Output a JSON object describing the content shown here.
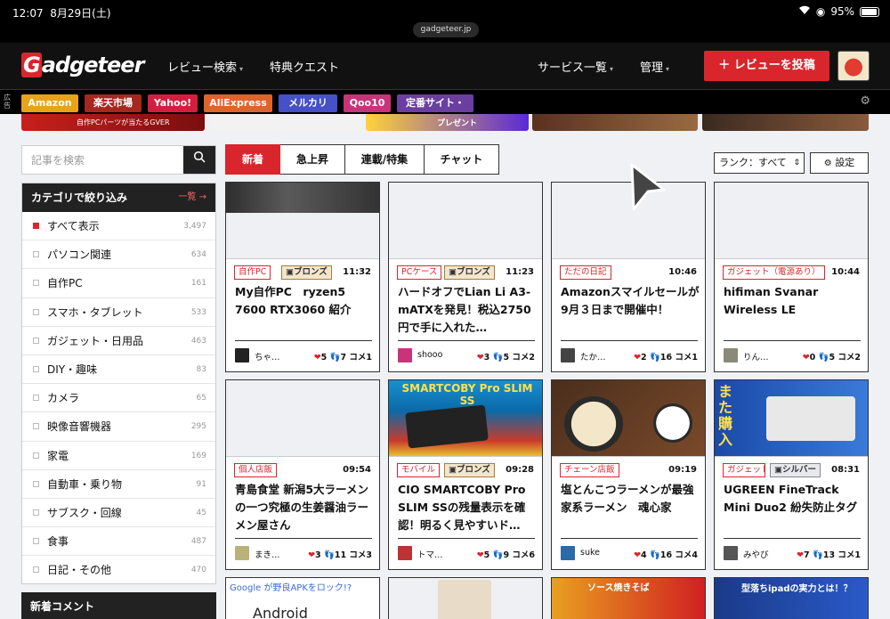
{
  "status": {
    "time": "12:07",
    "date": "8月29日(土)",
    "battery": "95%",
    "url": "gadgeteer.jp"
  },
  "header": {
    "logo": "Gadgeteer",
    "nav": [
      "レビュー検索",
      "特典クエスト",
      "サービス一覧",
      "管理"
    ],
    "post_button": "＋ レビューを投稿"
  },
  "shopbar": {
    "ad_mark": "広告",
    "links": [
      {
        "label": "Amazon",
        "color": "#e8a317"
      },
      {
        "label": "楽天市場",
        "color": "#a6271f"
      },
      {
        "label": "Yahoo!",
        "color": "#d31f3f"
      },
      {
        "label": "AliExpress",
        "color": "#e0632a"
      },
      {
        "label": "メルカリ",
        "color": "#4650c8"
      },
      {
        "label": "Qoo10",
        "color": "#c8337a"
      },
      {
        "label": "定番サイト・",
        "color": "#6b3fa0"
      }
    ]
  },
  "banners": [
    "自作PCパーツが当たるGVER",
    "プレゼント",
    "",
    ""
  ],
  "sidebar": {
    "search_placeholder": "記事を検索",
    "category_title": "カテゴリで絞り込み",
    "category_all": "一覧 →",
    "categories": [
      {
        "label": "すべて表示",
        "count": "3,497"
      },
      {
        "label": "パソコン関連",
        "count": "634"
      },
      {
        "label": "自作PC",
        "count": "161"
      },
      {
        "label": "スマホ・タブレット",
        "count": "533"
      },
      {
        "label": "ガジェット・日用品",
        "count": "463"
      },
      {
        "label": "DIY・趣味",
        "count": "83"
      },
      {
        "label": "カメラ",
        "count": "65"
      },
      {
        "label": "映像音響機器",
        "count": "295"
      },
      {
        "label": "家電",
        "count": "169"
      },
      {
        "label": "自動車・乗り物",
        "count": "91"
      },
      {
        "label": "サブスク・回線",
        "count": "45"
      },
      {
        "label": "食事",
        "count": "487"
      },
      {
        "label": "日記・その他",
        "count": "470"
      }
    ],
    "new_comments": "新着コメント"
  },
  "tabs": [
    "新着",
    "急上昇",
    "連載/特集",
    "チャット"
  ],
  "rank_select": "ランク：すべて",
  "settings_label": "設定",
  "cards": [
    {
      "cat": "自作PC",
      "badge": "ブロンズ",
      "time": "11:32",
      "title": "My自作PC　ryzen5 7600 RTX3060 紹介",
      "user": "ちゃ…",
      "hearts": "5",
      "steps": "7",
      "comments": "コメ1",
      "img": "#3a3a3a"
    },
    {
      "cat": "PCケース",
      "badge": "ブロンズ",
      "time": "11:23",
      "title": "ハードオフでLian Li A3-mATXを発見！税込2750円で手に入れた…",
      "user": "shooo",
      "hearts": "3",
      "steps": "5",
      "comments": "コメ2",
      "img": ""
    },
    {
      "cat": "ただの日記",
      "badge": "",
      "time": "10:46",
      "title": "Amazonスマイルセールが9月３日まで開催中！",
      "user": "たか…",
      "hearts": "2",
      "steps": "16",
      "comments": "コメ1",
      "img": ""
    },
    {
      "cat": "ガジェット（電源あり）",
      "badge": "",
      "time": "10:44",
      "title": "hifiman Svanar Wireless LE",
      "user": "りん…",
      "hearts": "0",
      "steps": "5",
      "comments": "コメ2",
      "img": ""
    },
    {
      "cat": "個人店飯",
      "badge": "",
      "time": "09:54",
      "title": "青島食堂 新潟5大ラーメンの一つ究極の生姜醤油ラーメン屋さん",
      "user": "まき…",
      "hearts": "3",
      "steps": "11",
      "comments": "コメ3",
      "img": ""
    },
    {
      "cat": "モバイル",
      "badge": "ブロンズ",
      "time": "09:28",
      "title": "CIO SMARTCOBY Pro SLIM SSの残量表示を確認！明るく見やすいド…",
      "user": "トマ…",
      "hearts": "5",
      "steps": "9",
      "comments": "コメ6",
      "img": "smartcoby",
      "img_text": "SMARTCOBY Pro SLIM SS"
    },
    {
      "cat": "チェーン店飯",
      "badge": "",
      "time": "09:19",
      "title": "塩とんこつラーメンが最強　家系ラーメン　魂心家",
      "user": "suke",
      "hearts": "4",
      "steps": "16",
      "comments": "コメ4",
      "img": "ramen"
    },
    {
      "cat": "ガジェット",
      "badge": "シルバー",
      "time": "08:31",
      "title": "UGREEN FineTrack Mini Duo2 紛失防止タグ",
      "user": "みやび",
      "hearts": "7",
      "steps": "13",
      "comments": "コメ1",
      "img": "ugreen",
      "img_text": "また購入"
    }
  ],
  "partial_cards": [
    {
      "img_text": "Google が野良APKをロック!?",
      "sub": "Android"
    },
    {
      "img_text": ""
    },
    {
      "img_text": "ソース焼きそば"
    },
    {
      "img_text": "型落ちipadの実力とは！？"
    }
  ]
}
